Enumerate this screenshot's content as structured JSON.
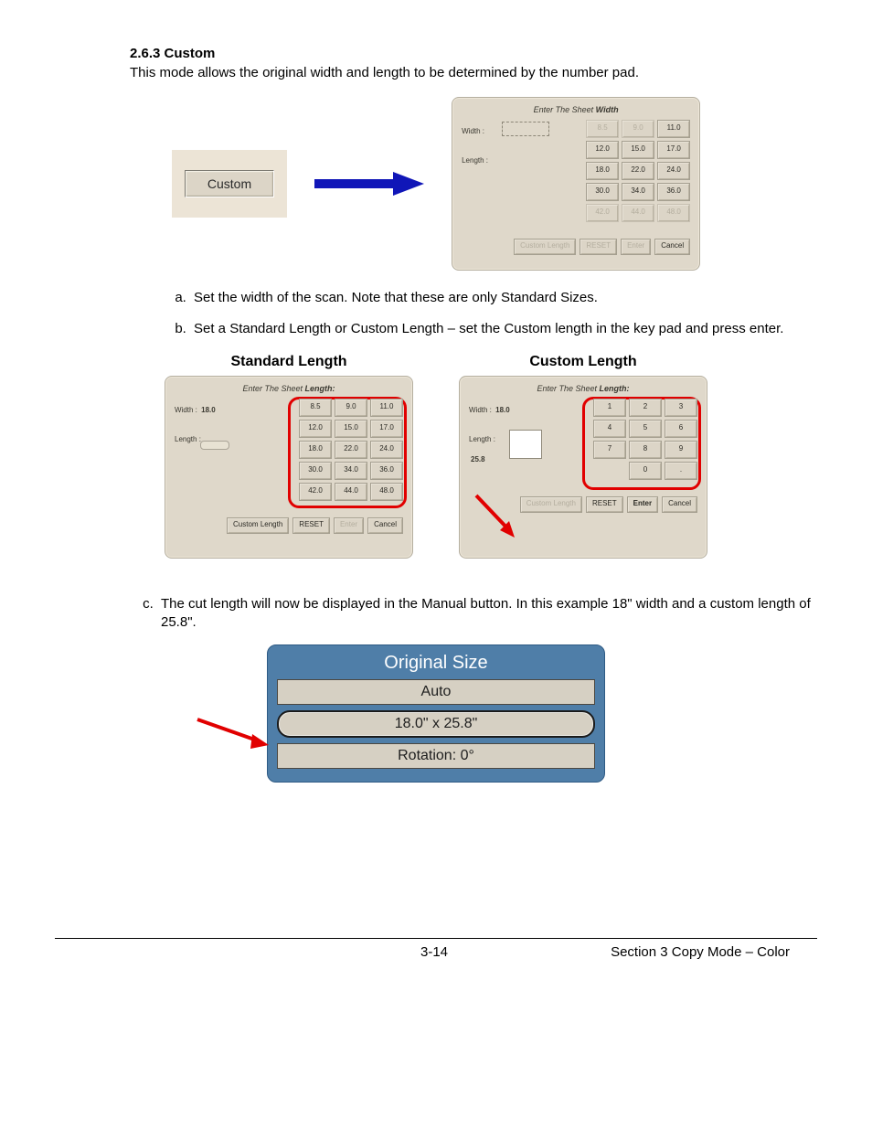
{
  "heading": "2.6.3   Custom",
  "intro": "This mode allows the original width and length to be determined by the number pad.",
  "custom_button_label": "Custom",
  "width_dialog": {
    "title_prefix": "Enter The Sheet ",
    "title_emph": "Width",
    "width_label": "Width :",
    "length_label": "Length :",
    "buttons": [
      {
        "v": "8.5",
        "ghost": true
      },
      {
        "v": "9.0",
        "ghost": true
      },
      {
        "v": "11.0"
      },
      {
        "v": "12.0"
      },
      {
        "v": "15.0"
      },
      {
        "v": "17.0"
      },
      {
        "v": "18.0"
      },
      {
        "v": "22.0"
      },
      {
        "v": "24.0"
      },
      {
        "v": "30.0"
      },
      {
        "v": "34.0"
      },
      {
        "v": "36.0"
      },
      {
        "v": "42.0",
        "ghost": true
      },
      {
        "v": "44.0",
        "ghost": true
      },
      {
        "v": "48.0",
        "ghost": true
      }
    ],
    "bottom": [
      {
        "v": "Custom Length",
        "ghost": true
      },
      {
        "v": "RESET",
        "ghost": true
      },
      {
        "v": "Enter",
        "ghost": true
      },
      {
        "v": "Cancel"
      }
    ]
  },
  "step_a": "Set the width of the scan. Note that these are only Standard Sizes.",
  "step_b": "Set a Standard Length or Custom Length – set the Custom length in the key pad and press enter.",
  "standard_length_title": "Standard Length",
  "custom_length_title": "Custom Length",
  "length_dialog": {
    "title_prefix": "Enter The Sheet ",
    "title_emph": "Length:",
    "width_label": "Width :",
    "width_value": "18.0",
    "length_label": "Length :",
    "buttons": [
      {
        "v": "8.5"
      },
      {
        "v": "9.0"
      },
      {
        "v": "11.0"
      },
      {
        "v": "12.0"
      },
      {
        "v": "15.0"
      },
      {
        "v": "17.0"
      },
      {
        "v": "18.0"
      },
      {
        "v": "22.0"
      },
      {
        "v": "24.0"
      },
      {
        "v": "30.0"
      },
      {
        "v": "34.0"
      },
      {
        "v": "36.0"
      },
      {
        "v": "42.0"
      },
      {
        "v": "44.0"
      },
      {
        "v": "48.0"
      }
    ],
    "bottom": [
      {
        "v": "Custom Length"
      },
      {
        "v": "RESET"
      },
      {
        "v": "Enter",
        "ghost": true
      },
      {
        "v": "Cancel"
      }
    ]
  },
  "numpad_dialog": {
    "title_prefix": "Enter The Sheet ",
    "title_emph": "Length:",
    "width_label": "Width :",
    "width_value": "18.0",
    "length_label": "Length :",
    "length_value": "25.8",
    "keys": [
      "1",
      "2",
      "3",
      "4",
      "5",
      "6",
      "7",
      "8",
      "9",
      "",
      "0",
      "."
    ],
    "bottom": [
      {
        "v": "Custom Length",
        "ghost": true
      },
      {
        "v": "RESET"
      },
      {
        "v": "Enter"
      },
      {
        "v": "Cancel"
      }
    ]
  },
  "step_c": "The cut length will now be displayed in the Manual button. In this example 18\" width and a custom length of 25.8\".",
  "result": {
    "header": "Original Size",
    "auto": "Auto",
    "dims": "18.0\" x 25.8\"",
    "rotation": "Rotation: 0°"
  },
  "footer": {
    "page": "3-14",
    "section": "Section 3     Copy Mode – Color"
  }
}
